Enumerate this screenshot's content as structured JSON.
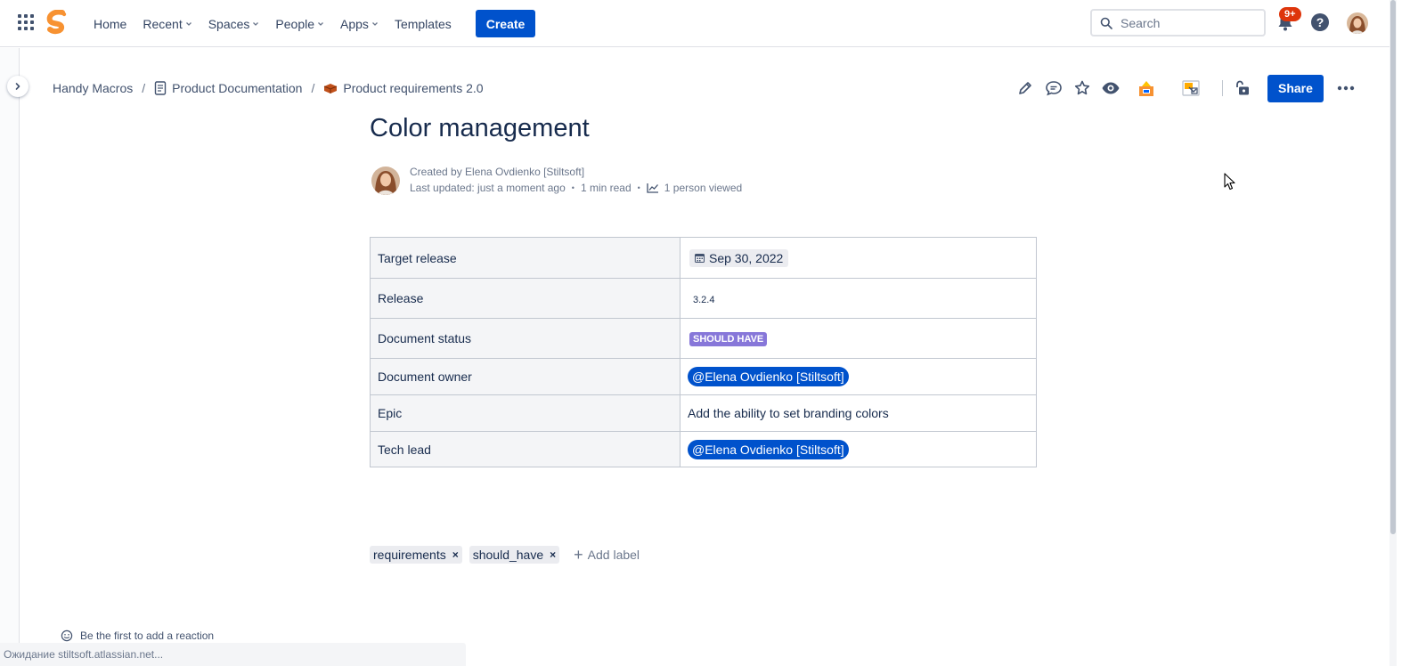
{
  "topnav": {
    "items": [
      {
        "label": "Home",
        "has_chevron": false
      },
      {
        "label": "Recent",
        "has_chevron": true
      },
      {
        "label": "Spaces",
        "has_chevron": true
      },
      {
        "label": "People",
        "has_chevron": true
      },
      {
        "label": "Apps",
        "has_chevron": true
      },
      {
        "label": "Templates",
        "has_chevron": false
      }
    ],
    "create_label": "Create",
    "search_placeholder": "Search",
    "notification_count": "9+",
    "help_glyph": "?"
  },
  "breadcrumb": {
    "items": [
      {
        "label": "Handy Macros",
        "icon": "none"
      },
      {
        "label": "Product Documentation",
        "icon": "page-icon"
      },
      {
        "label": "Product requirements 2.0",
        "icon": "emoji-brick-icon"
      }
    ],
    "separator": "/"
  },
  "actions": {
    "share_label": "Share",
    "icons": [
      "edit-icon",
      "comment-icon",
      "star-icon",
      "watch-icon",
      "app-macro-icon",
      "app-image-icon",
      "restrictions-icon",
      "more-icon"
    ]
  },
  "page": {
    "title": "Color management",
    "created_by": "Created by Elena Ovdienko [Stiltsoft]",
    "last_updated": "Last updated: just a moment ago",
    "read_time": "1 min read",
    "viewed": "1 person viewed"
  },
  "table": {
    "rows": [
      {
        "key": "Target release",
        "type": "date",
        "value": "Sep 30, 2022"
      },
      {
        "key": "Release",
        "type": "version",
        "value": "3.2.4"
      },
      {
        "key": "Document status",
        "type": "status",
        "value": "SHOULD HAVE"
      },
      {
        "key": "Document owner",
        "type": "mention",
        "value": "@Elena Ovdienko [Stiltsoft]"
      },
      {
        "key": "Epic",
        "type": "text",
        "value": "Add the ability to set branding colors"
      },
      {
        "key": "Tech lead",
        "type": "mention",
        "value": "@Elena Ovdienko [Stiltsoft]"
      }
    ]
  },
  "labels": {
    "items": [
      "requirements",
      "should_have"
    ],
    "remove_glyph": "×",
    "add_label": "Add label"
  },
  "reaction": {
    "text": "Be the first to add a reaction"
  },
  "statusbar": {
    "text": "Ожидание stiltsoft.atlassian.net..."
  },
  "colors": {
    "brand_blue": "#0052cc",
    "status_purple": "#8777d9",
    "logo_orange": "#f79232",
    "notif_red": "#de350b"
  }
}
